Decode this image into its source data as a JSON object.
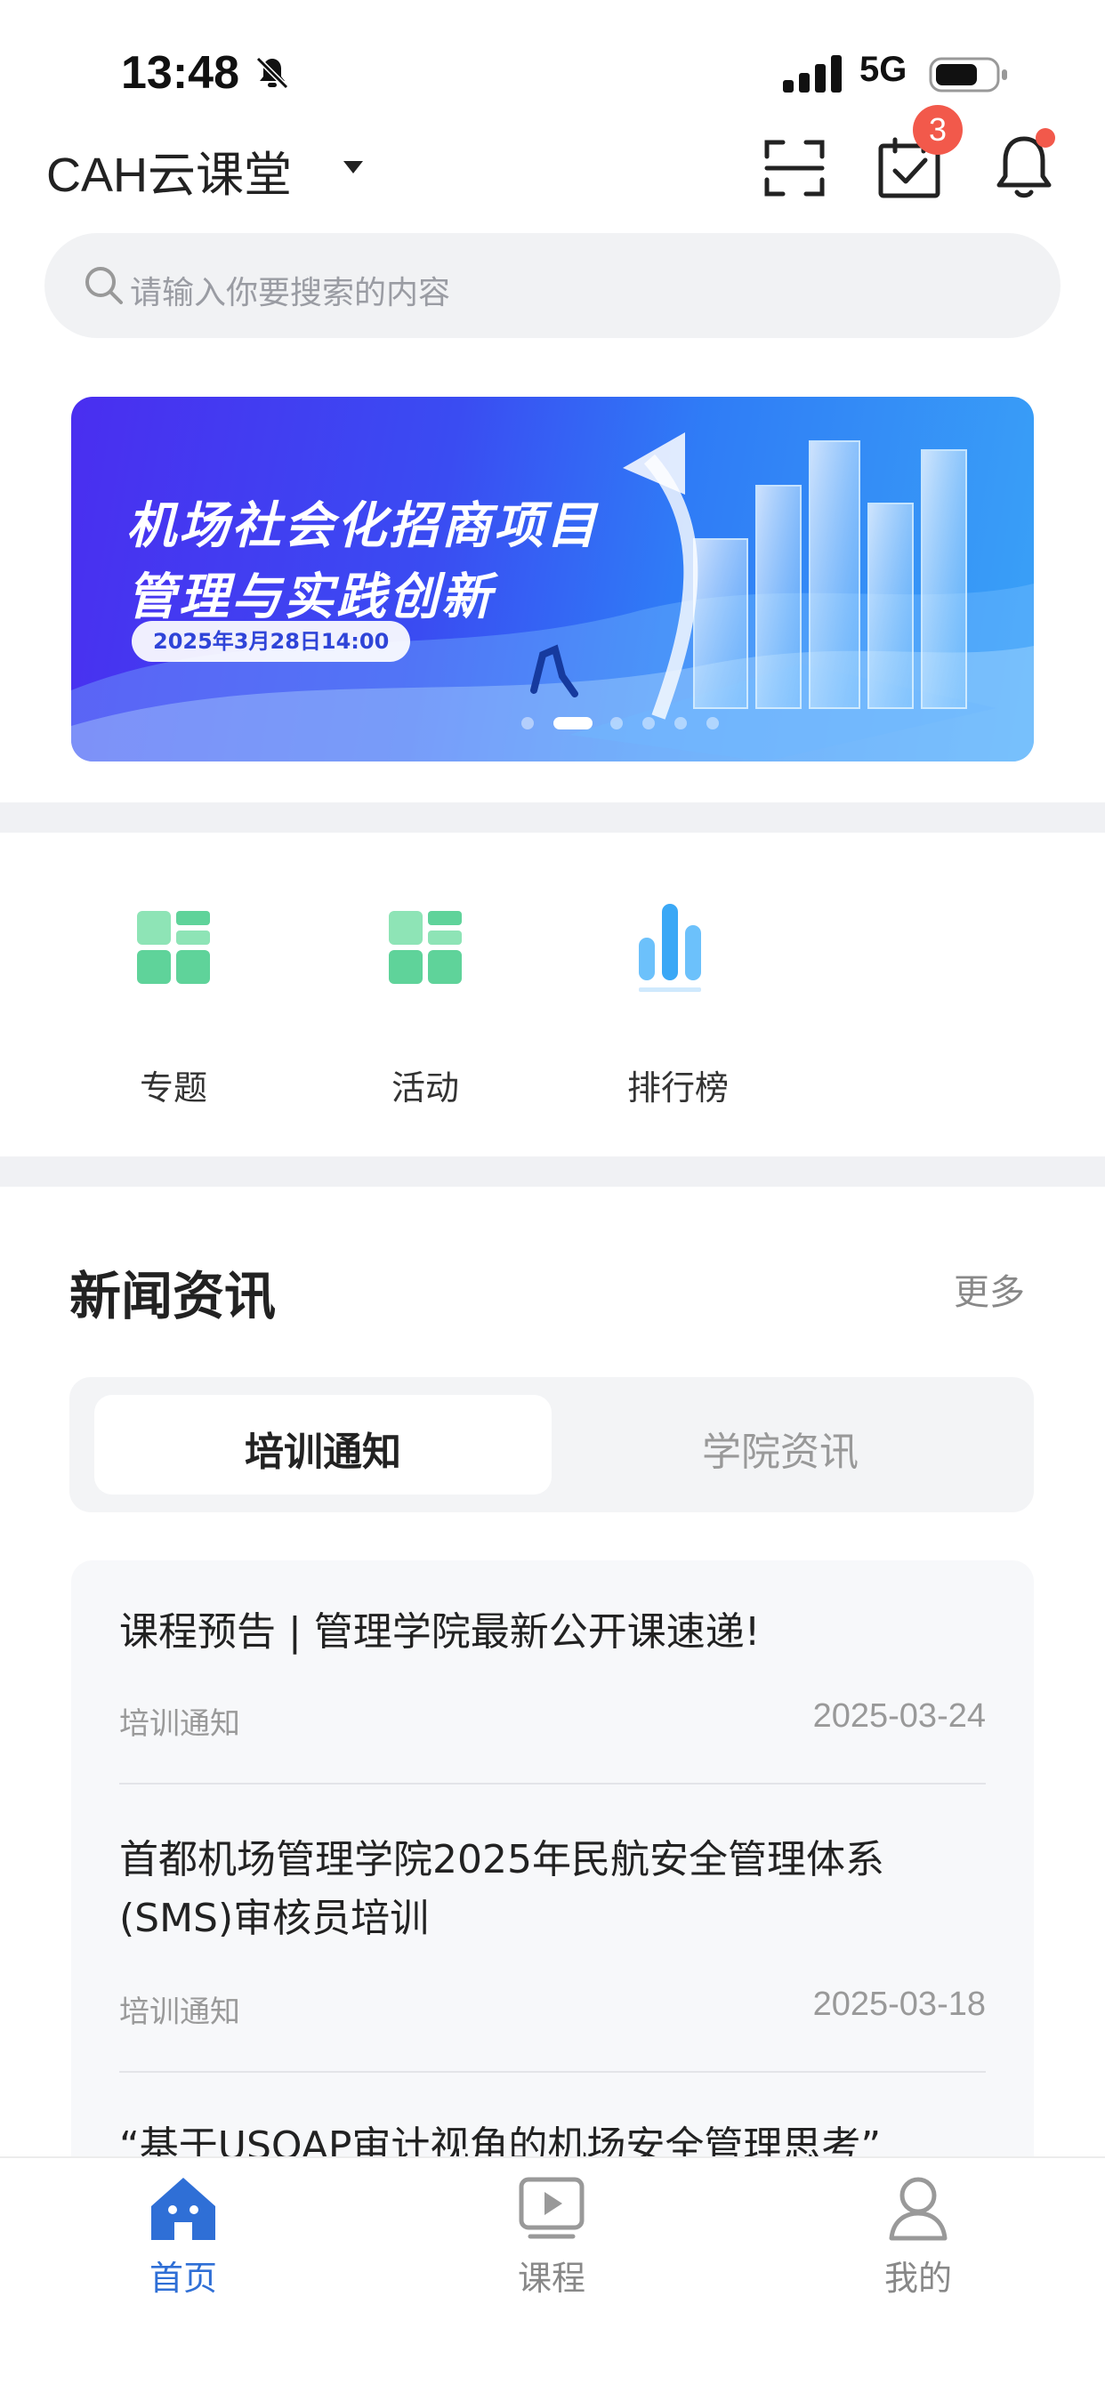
{
  "status_bar": {
    "time": "13:48",
    "network": "5G"
  },
  "header": {
    "title": "CAH云课堂",
    "tasks_badge": "3"
  },
  "search": {
    "placeholder": "请输入你要搜索的内容"
  },
  "banner": {
    "line1": "机场社会化招商项目",
    "line2": "管理与实践创新",
    "date": "2025年3月28日14:00",
    "slide_count": 6,
    "active_slide": 1
  },
  "quick_entries": [
    {
      "label": "专题",
      "icon": "grid-icon"
    },
    {
      "label": "活动",
      "icon": "grid-icon"
    },
    {
      "label": "排行榜",
      "icon": "bar-chart-icon"
    }
  ],
  "news": {
    "title": "新闻资讯",
    "more": "更多",
    "tabs": [
      {
        "label": "培训通知",
        "active": true
      },
      {
        "label": "学院资讯",
        "active": false
      }
    ],
    "items": [
      {
        "title": "课程预告 | 管理学院最新公开课速递!",
        "tag": "培训通知",
        "date": "2025-03-24"
      },
      {
        "title": "首都机场管理学院2025年民航安全管理体系(SMS)审核员培训",
        "tag": "培训通知",
        "date": "2025-03-18"
      },
      {
        "title": "“基于USOAP审计视角的机场安全管理思考”",
        "tag": "",
        "date": ""
      }
    ]
  },
  "tabbar": {
    "items": [
      {
        "label": "首页",
        "icon": "home-icon",
        "active": true
      },
      {
        "label": "课程",
        "icon": "play-icon",
        "active": false
      },
      {
        "label": "我的",
        "icon": "user-icon",
        "active": false
      }
    ]
  },
  "colors": {
    "accent": "#2f6fd6",
    "badge": "#f2594b",
    "green_icon": "#5fd39a",
    "blue_icon": "#4aa8f5"
  }
}
